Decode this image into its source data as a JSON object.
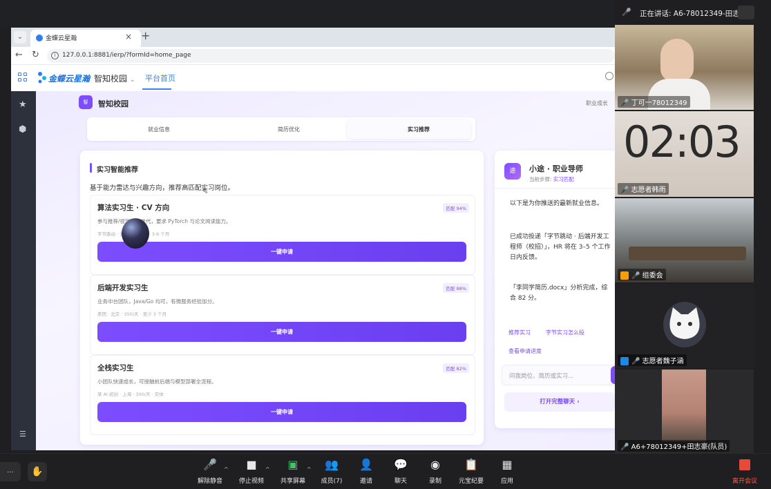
{
  "speaking": {
    "prefix": "正在讲话:",
    "name": "A6-78012349-田志..."
  },
  "browser": {
    "tab_title": "金蝶云星瀚",
    "url": "127.0.0.1:8881/ierp/?formId=home_page"
  },
  "app": {
    "logo_text": "金蝶云星瀚",
    "campus_menu": "智知校园",
    "home_tab": "平台首页",
    "badge": "智",
    "title": "智知校园",
    "career_link": "职业成长",
    "tabs": [
      "就业信息",
      "简历优化",
      "实习推荐"
    ],
    "active_tab": "实习推荐"
  },
  "recommend": {
    "section_title": "实习智能推荐",
    "subtitle": "基于能力雷达与兴趣方向，推荐高匹配实习岗位。",
    "jobs": [
      {
        "title": "算法实习生 · CV 方向",
        "match": "匹配 94%",
        "desc": "参与推荐/视觉算法迭代，要求 PyTorch 与论文阅读能力。",
        "meta": "字节跳动 · 北京 · 400/天 · 3-6 个月",
        "apply": "一键申请"
      },
      {
        "title": "后端开发实习生",
        "match": "匹配 88%",
        "desc": "业务中台团队，Java/Go 均可，有微服务经验加分。",
        "meta": "美团 · 北京 · 350/天 · 至少 3 个月",
        "apply": "一键申请"
      },
      {
        "title": "全栈实习生",
        "match": "匹配 82%",
        "desc": "小团队快速成长，可接触前后端与模型部署全流程。",
        "meta": "某 AI 初创 · 上海 · 300/天 · 实体",
        "apply": "一键申请"
      }
    ]
  },
  "assistant": {
    "avatar": "途",
    "name": "小途 · 职业导师",
    "step_label": "当前步骤:",
    "step_value": "实习匹配",
    "messages": [
      "以下是为你推送的最新就业信息。",
      "已成功投递「字节跳动 · 后端开发工程师（校招）」，HR 将在 3–5 个工作日内反馈。",
      "「李同学简历.docx」分析完成，综合 82 分。"
    ],
    "quick_links": [
      "推荐实习",
      "字节实习怎么投",
      "查看申请进度"
    ],
    "input_placeholder": "问我岗位、简历或实习...",
    "open_chat": "打开完整聊天 ›"
  },
  "meeting": {
    "participants": [
      {
        "name": "丁可一78012349"
      },
      {
        "name": "志愿者韩雨",
        "clock": "02:03"
      },
      {
        "name": "组委会"
      },
      {
        "name": "志愿者魏子涵"
      },
      {
        "name": "A6+78012349+田志豪(队员)"
      }
    ],
    "toolbar": [
      {
        "icon": "mic-off-icon",
        "label": "解除静音"
      },
      {
        "icon": "video-icon",
        "label": "停止视频"
      },
      {
        "icon": "share-screen-icon",
        "label": "共享屏幕"
      },
      {
        "icon": "members-icon",
        "label": "成员(7)"
      },
      {
        "icon": "invite-icon",
        "label": "邀请"
      },
      {
        "icon": "chat-icon",
        "label": "聊天"
      },
      {
        "icon": "record-icon",
        "label": "录制"
      },
      {
        "icon": "ai-minutes-icon",
        "label": "元宝纪要"
      },
      {
        "icon": "apps-icon",
        "label": "应用"
      }
    ],
    "leave": "离开会议"
  }
}
